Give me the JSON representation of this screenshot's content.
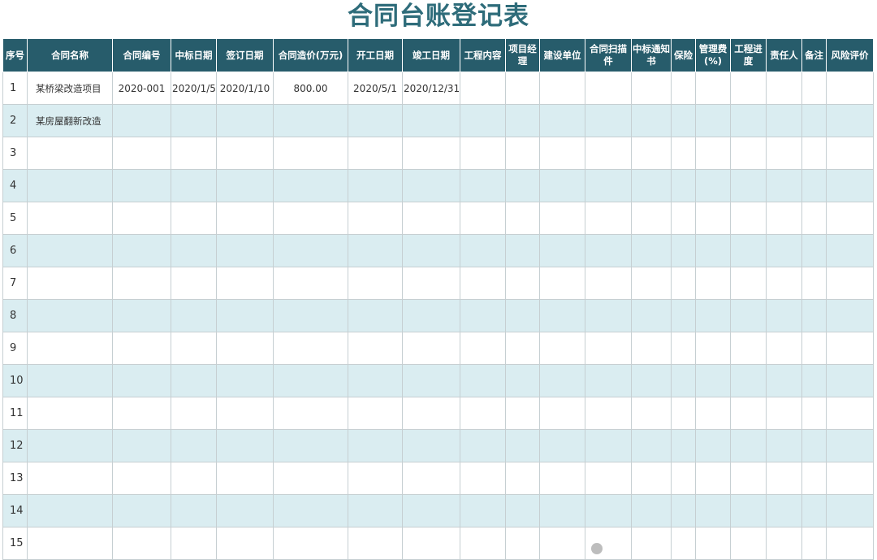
{
  "title": "合同台账登记表",
  "headers": [
    "序号",
    "合同名称",
    "合同编号",
    "中标日期",
    "签订日期",
    "合同造价(万元)",
    "开工日期",
    "竣工日期",
    "工程内容",
    "项目经理",
    "建设单位",
    "合同扫描件",
    "中标通知书",
    "保险",
    "管理费(%)",
    "工程进度",
    "责任人",
    "备注",
    "风险评价"
  ],
  "rows": [
    {
      "seq": "1",
      "name": "某桥梁改造项目",
      "code": "2020-001",
      "bid_date": "2020/1/5",
      "sign_date": "2020/1/10",
      "price": "800.00",
      "start": "2020/5/1",
      "end": "2020/12/31"
    },
    {
      "seq": "2",
      "name": "某房屋翻新改造",
      "code": "",
      "bid_date": "",
      "sign_date": "",
      "price": "",
      "start": "",
      "end": ""
    },
    {
      "seq": "3",
      "name": "",
      "code": "",
      "bid_date": "",
      "sign_date": "",
      "price": "",
      "start": "",
      "end": ""
    },
    {
      "seq": "4",
      "name": "",
      "code": "",
      "bid_date": "",
      "sign_date": "",
      "price": "",
      "start": "",
      "end": ""
    },
    {
      "seq": "5",
      "name": "",
      "code": "",
      "bid_date": "",
      "sign_date": "",
      "price": "",
      "start": "",
      "end": ""
    },
    {
      "seq": "6",
      "name": "",
      "code": "",
      "bid_date": "",
      "sign_date": "",
      "price": "",
      "start": "",
      "end": ""
    },
    {
      "seq": "7",
      "name": "",
      "code": "",
      "bid_date": "",
      "sign_date": "",
      "price": "",
      "start": "",
      "end": ""
    },
    {
      "seq": "8",
      "name": "",
      "code": "",
      "bid_date": "",
      "sign_date": "",
      "price": "",
      "start": "",
      "end": ""
    },
    {
      "seq": "9",
      "name": "",
      "code": "",
      "bid_date": "",
      "sign_date": "",
      "price": "",
      "start": "",
      "end": ""
    },
    {
      "seq": "10",
      "name": "",
      "code": "",
      "bid_date": "",
      "sign_date": "",
      "price": "",
      "start": "",
      "end": ""
    },
    {
      "seq": "11",
      "name": "",
      "code": "",
      "bid_date": "",
      "sign_date": "",
      "price": "",
      "start": "",
      "end": ""
    },
    {
      "seq": "12",
      "name": "",
      "code": "",
      "bid_date": "",
      "sign_date": "",
      "price": "",
      "start": "",
      "end": ""
    },
    {
      "seq": "13",
      "name": "",
      "code": "",
      "bid_date": "",
      "sign_date": "",
      "price": "",
      "start": "",
      "end": ""
    },
    {
      "seq": "14",
      "name": "",
      "code": "",
      "bid_date": "",
      "sign_date": "",
      "price": "",
      "start": "",
      "end": ""
    },
    {
      "seq": "15",
      "name": "",
      "code": "",
      "bid_date": "",
      "sign_date": "",
      "price": "",
      "start": "",
      "end": ""
    }
  ],
  "colors": {
    "header_bg": "#275c6b",
    "title": "#2e6c7a",
    "stripe": "#daedf1",
    "grid": "#c6cfd2"
  }
}
